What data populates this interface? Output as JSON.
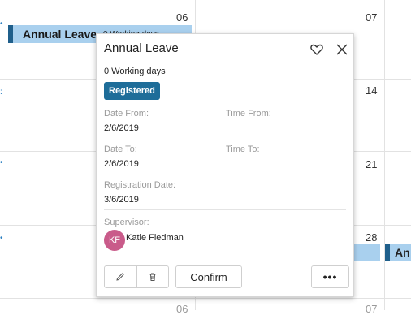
{
  "calendar": {
    "day_numbers": [
      "06",
      "07",
      "14",
      "21",
      "28",
      "06",
      "07"
    ],
    "event_title": "Annual Leave",
    "event_subtitle": "0 Working days",
    "event_partial": "An"
  },
  "popup": {
    "title": "Annual Leave",
    "working_days": "0 Working days",
    "status": "Registered",
    "date_from_label": "Date From:",
    "date_from": "2/6/2019",
    "time_from_label": "Time From:",
    "date_to_label": "Date To:",
    "date_to": "2/6/2019",
    "time_to_label": "Time To:",
    "registration_date_label": "Registration Date:",
    "registration_date": "3/6/2019",
    "supervisor_label": "Supervisor:",
    "supervisor_initials": "KF",
    "supervisor_name": "Katie Fledman",
    "confirm_label": "Confirm",
    "more_label": "•••",
    "icons": {
      "favorite": "heart-icon",
      "close": "close-icon",
      "edit": "pencil-icon",
      "delete": "trash-icon"
    },
    "colors": {
      "badge": "#1e6d99",
      "avatar": "#c95b8a",
      "event_fill": "#a9d0ee",
      "event_accent": "#1f5f8b"
    }
  }
}
